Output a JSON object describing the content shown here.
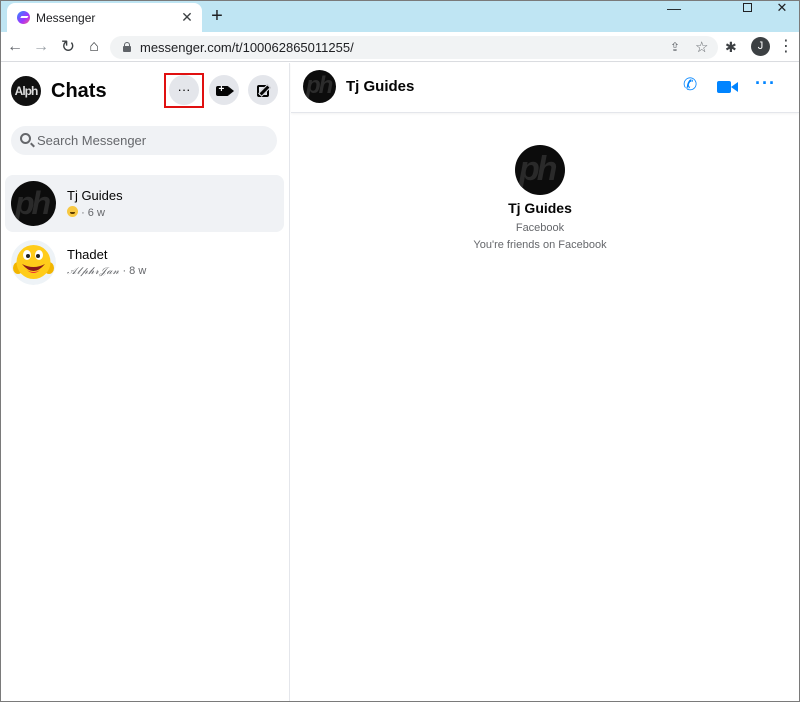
{
  "browser": {
    "tab_title": "Messenger",
    "tab_close": "✕",
    "new_tab": "+",
    "url": "messenger.com/t/100062865011255/",
    "profile_initial": "J",
    "window_controls": {
      "minimize": "—",
      "close": "✕"
    }
  },
  "sidebar": {
    "avatar_text": "Alph",
    "title": "Chats",
    "options_label": "···",
    "search_placeholder": "Search Messenger",
    "chats": [
      {
        "name": "Tj Guides",
        "avatar_text": "ph",
        "meta": "· 6 w",
        "emoji": "😀"
      },
      {
        "name": "Thadet",
        "preview": "𝒜𝓁𝓅𝒽𝓇𝒥𝒶𝓃",
        "meta": "· 8 w"
      }
    ]
  },
  "conversation": {
    "name": "Tj Guides",
    "avatar_text": "ph",
    "more_label": "···",
    "profile_name": "Tj Guides",
    "profile_source": "Facebook",
    "profile_relation": "You're friends on Facebook"
  },
  "colors": {
    "accent": "#0084ff",
    "highlight_box": "#e01010",
    "tabstrip": "#bfe5f3"
  },
  "icons": [
    "messenger-favicon",
    "back-arrow-icon",
    "forward-arrow-icon",
    "reload-icon",
    "home-icon",
    "lock-icon",
    "share-icon",
    "star-icon",
    "extensions-icon",
    "more-vert-icon",
    "video-plus-icon",
    "compose-icon",
    "search-icon",
    "phone-icon",
    "video-icon",
    "more-icon"
  ]
}
